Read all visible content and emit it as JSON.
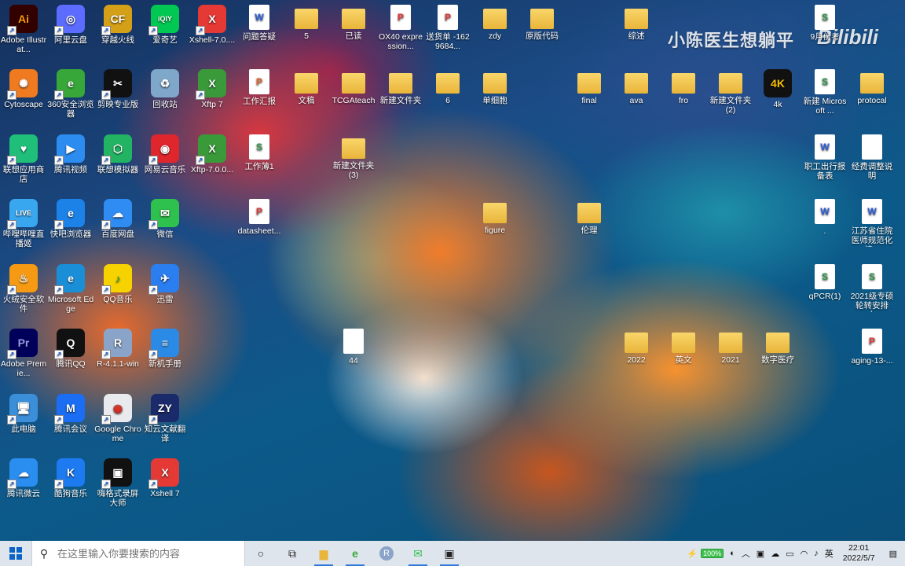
{
  "desktop": {
    "watermark": "小陈医生想躺平",
    "bilibili": "Bilibili",
    "icons": [
      {
        "label": "Adobe Illustrat...",
        "glyph": "Ai",
        "color": "#330000",
        "fg": "#ff9a00"
      },
      {
        "label": "阿里云盘",
        "glyph": "◎",
        "color": "#5b6cff",
        "fg": "#fff"
      },
      {
        "label": "穿越火线",
        "glyph": "CF",
        "color": "#d4a017",
        "fg": "#fff"
      },
      {
        "label": "爱奇艺",
        "glyph": "iQIY",
        "color": "#00c853",
        "fg": "#fff"
      },
      {
        "label": "Xshell-7.0....",
        "glyph": "X",
        "color": "#e53935",
        "fg": "#fff"
      },
      {
        "label": "问题答疑",
        "glyph": "W",
        "color": "#2b5fd9",
        "fg": "#fff"
      },
      {
        "label": "5",
        "glyph": "",
        "color": "#f3c94f",
        "fg": "#fff"
      },
      {
        "label": "已读",
        "glyph": "",
        "color": "#f3c94f",
        "fg": "#fff"
      },
      {
        "label": "OX40 expression...",
        "glyph": "P",
        "color": "#e53935",
        "fg": "#fff"
      },
      {
        "label": "送货单 -1629684...",
        "glyph": "P",
        "color": "#e53935",
        "fg": "#fff"
      },
      {
        "label": "zdy",
        "glyph": "",
        "color": "#f3c94f",
        "fg": "#fff"
      },
      {
        "label": "原版代码",
        "glyph": "",
        "color": "#f3c94f",
        "fg": "#fff"
      },
      {
        "label": "综述",
        "glyph": "",
        "color": "#f3c94f",
        "fg": "#fff"
      },
      {
        "label": "9月份考",
        "glyph": "S",
        "color": "#2e9a48",
        "fg": "#fff"
      },
      {
        "label": "Cytoscape",
        "glyph": "✺",
        "color": "#f07a1f",
        "fg": "#fff"
      },
      {
        "label": "360安全浏览器",
        "glyph": "e",
        "color": "#37a73a",
        "fg": "#fff"
      },
      {
        "label": "剪映专业版",
        "glyph": "✂",
        "color": "#111",
        "fg": "#fff"
      },
      {
        "label": "回收站",
        "glyph": "♻",
        "color": "#7ea7c9",
        "fg": "#fff"
      },
      {
        "label": "Xftp 7",
        "glyph": "X",
        "color": "#3a9a3a",
        "fg": "#fff"
      },
      {
        "label": "工作汇报",
        "glyph": "P",
        "color": "#e8632a",
        "fg": "#fff"
      },
      {
        "label": "文稿",
        "glyph": "",
        "color": "#f3c94f",
        "fg": "#fff"
      },
      {
        "label": "TCGAteach",
        "glyph": "",
        "color": "#f3c94f",
        "fg": "#fff"
      },
      {
        "label": "新建文件夹",
        "glyph": "",
        "color": "#f3c94f",
        "fg": "#fff"
      },
      {
        "label": "6",
        "glyph": "",
        "color": "#f3c94f",
        "fg": "#fff"
      },
      {
        "label": "单细胞",
        "glyph": "",
        "color": "#f3c94f",
        "fg": "#fff"
      },
      {
        "label": "final",
        "glyph": "",
        "color": "#f3c94f",
        "fg": "#fff"
      },
      {
        "label": "ava",
        "glyph": "",
        "color": "#f3c94f",
        "fg": "#fff"
      },
      {
        "label": "fro",
        "glyph": "",
        "color": "#f3c94f",
        "fg": "#fff"
      },
      {
        "label": "新建文件夹 (2)",
        "glyph": "",
        "color": "#f3c94f",
        "fg": "#fff"
      },
      {
        "label": "4k",
        "glyph": "4K",
        "color": "#111",
        "fg": "#f6c000"
      },
      {
        "label": "新建 Microsoft ...",
        "glyph": "S",
        "color": "#2e9a48",
        "fg": "#fff"
      },
      {
        "label": "protocal",
        "glyph": "",
        "color": "#f3c94f",
        "fg": "#fff"
      },
      {
        "label": "联想应用商店",
        "glyph": "♥",
        "color": "#1fbf7a",
        "fg": "#fff"
      },
      {
        "label": "腾讯视频",
        "glyph": "▶",
        "color": "#2d8cf0",
        "fg": "#fff"
      },
      {
        "label": "联想模拟器",
        "glyph": "⬡",
        "color": "#22b463",
        "fg": "#fff"
      },
      {
        "label": "网易云音乐",
        "glyph": "◉",
        "color": "#e0262d",
        "fg": "#fff"
      },
      {
        "label": "Xftp-7.0.0...",
        "glyph": "X",
        "color": "#3a9a3a",
        "fg": "#fff"
      },
      {
        "label": "工作薄1",
        "glyph": "S",
        "color": "#2e9a48",
        "fg": "#fff"
      },
      {
        "label": "新建文件夹 (3)",
        "glyph": "",
        "color": "#f3c94f",
        "fg": "#fff"
      },
      {
        "label": "职工出行报备表",
        "glyph": "W",
        "color": "#2b5fd9",
        "fg": "#fff"
      },
      {
        "label": "经费调整说明",
        "glyph": "",
        "color": "#e8e8e8",
        "fg": "#333"
      },
      {
        "label": "哔哩哔哩直播姬",
        "glyph": "LIVE",
        "color": "#39a7f0",
        "fg": "#fff"
      },
      {
        "label": "快吧浏览器",
        "glyph": "e",
        "color": "#1d82e8",
        "fg": "#fff"
      },
      {
        "label": "百度网盘",
        "glyph": "☁",
        "color": "#2f8cf3",
        "fg": "#fff"
      },
      {
        "label": "微信",
        "glyph": "✉",
        "color": "#2ec14d",
        "fg": "#fff"
      },
      {
        "label": "datasheet...",
        "glyph": "P",
        "color": "#e53935",
        "fg": "#fff"
      },
      {
        "label": "figure",
        "glyph": "",
        "color": "#f3c94f",
        "fg": "#fff"
      },
      {
        "label": "伦理",
        "glyph": "",
        "color": "#f3c94f",
        "fg": "#fff"
      },
      {
        "label": ".",
        "glyph": "W",
        "color": "#2b5fd9",
        "fg": "#fff"
      },
      {
        "label": "江苏省住院医师规范化培...",
        "glyph": "W",
        "color": "#2b5fd9",
        "fg": "#fff"
      },
      {
        "label": "火绒安全软件",
        "glyph": "♨",
        "color": "#f59a12",
        "fg": "#fff"
      },
      {
        "label": "Microsoft Edge",
        "glyph": "e",
        "color": "#1a8fd8",
        "fg": "#fff"
      },
      {
        "label": "QQ音乐",
        "glyph": "♪",
        "color": "#f6d300",
        "fg": "#1aa34a"
      },
      {
        "label": "迅雷",
        "glyph": "✈",
        "color": "#2b7ef0",
        "fg": "#fff"
      },
      {
        "label": "qPCR(1)",
        "glyph": "S",
        "color": "#2e9a48",
        "fg": "#fff"
      },
      {
        "label": "2021级专硕轮转安排（...",
        "glyph": "S",
        "color": "#2e9a48",
        "fg": "#fff"
      },
      {
        "label": "Adobe Premie...",
        "glyph": "Pr",
        "color": "#00005b",
        "fg": "#9999ff"
      },
      {
        "label": "腾讯QQ",
        "glyph": "Q",
        "color": "#111",
        "fg": "#fff"
      },
      {
        "label": "R-4.1.1-win",
        "glyph": "R",
        "color": "#8aa4c9",
        "fg": "#fff"
      },
      {
        "label": "新机手册",
        "glyph": "≡",
        "color": "#2b8ae5",
        "fg": "#fff"
      },
      {
        "label": "44",
        "glyph": "",
        "color": "#f2f2f2",
        "fg": "#333"
      },
      {
        "label": "2022",
        "glyph": "",
        "color": "#f3c94f",
        "fg": "#fff"
      },
      {
        "label": "英文",
        "glyph": "",
        "color": "#f3c94f",
        "fg": "#fff"
      },
      {
        "label": "2021",
        "glyph": "",
        "color": "#f3c94f",
        "fg": "#fff"
      },
      {
        "label": "数字医疗",
        "glyph": "",
        "color": "#f3c94f",
        "fg": "#fff"
      },
      {
        "label": "aging-13-...",
        "glyph": "P",
        "color": "#e53935",
        "fg": "#fff"
      },
      {
        "label": "此电脑",
        "glyph": "🖥",
        "color": "#3b8fd8",
        "fg": "#fff"
      },
      {
        "label": "腾讯会议",
        "glyph": "M",
        "color": "#1b6ef3",
        "fg": "#fff"
      },
      {
        "label": "Google Chrome",
        "glyph": "◉",
        "color": "#e8eaed",
        "fg": "#d93025"
      },
      {
        "label": "知云文献翻译",
        "glyph": "ZY",
        "color": "#1b2a6b",
        "fg": "#fff"
      },
      {
        "label": "腾讯微云",
        "glyph": "☁",
        "color": "#2a8df0",
        "fg": "#fff"
      },
      {
        "label": "酷狗音乐",
        "glyph": "K",
        "color": "#1d7af0",
        "fg": "#fff"
      },
      {
        "label": "嗨格式录屏大师",
        "glyph": "▣",
        "color": "#111",
        "fg": "#fff"
      },
      {
        "label": "Xshell 7",
        "glyph": "X",
        "color": "#e53935",
        "fg": "#fff"
      }
    ]
  },
  "taskbar": {
    "search_placeholder": "在这里输入你要搜索的内容",
    "battery": "100%",
    "ime": "英",
    "time": "22:01",
    "date": "2022/5/7"
  }
}
